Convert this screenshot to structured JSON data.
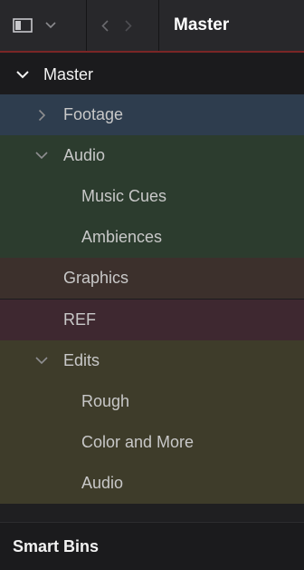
{
  "toolbar": {
    "sidebar_toggle_icon": "sidebar-panel-icon",
    "dropdown_icon": "chevron-down-icon",
    "back_icon": "chevron-left-icon",
    "forward_icon": "chevron-right-icon",
    "title": "Master"
  },
  "tree": {
    "root_label": "Master",
    "items": [
      {
        "label": "Footage",
        "color": "#2e3d4e"
      },
      {
        "label": "Audio",
        "color": "#2c3c2e"
      },
      {
        "label": "Music Cues",
        "color": "#2c3c2e"
      },
      {
        "label": "Ambiences",
        "color": "#2c3c2e"
      },
      {
        "label": "Graphics",
        "color": "#3c302c"
      },
      {
        "label": "REF",
        "color": "#3e2830"
      },
      {
        "label": "Edits",
        "color": "#3e3c2a"
      },
      {
        "label": "Rough",
        "color": "#3e3c2a"
      },
      {
        "label": "Color and More",
        "color": "#3e3c2a"
      },
      {
        "label": "Audio",
        "color": "#3e3c2a"
      }
    ]
  },
  "smart_bins": {
    "label": "Smart Bins"
  }
}
